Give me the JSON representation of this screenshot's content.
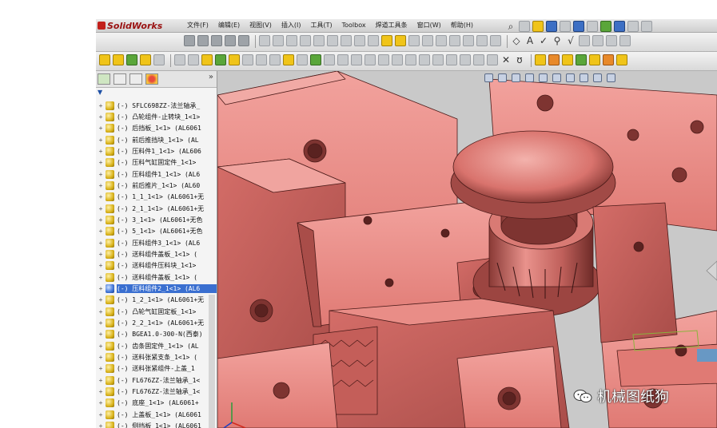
{
  "app": {
    "logo_text": "SolidWorks",
    "brand_color": "#c2201b"
  },
  "menu": [
    {
      "label": "文件(F)"
    },
    {
      "label": "编辑(E)"
    },
    {
      "label": "视图(V)"
    },
    {
      "label": "插入(I)"
    },
    {
      "label": "工具(T)"
    },
    {
      "label": "Toolbox"
    },
    {
      "label": "焊道工具条"
    },
    {
      "label": "窗口(W)"
    },
    {
      "label": "帮助(H)"
    }
  ],
  "panel": {
    "tabs": [
      "feature-manager-tab-icon",
      "property-manager-tab-icon",
      "configuration-manager-tab-icon",
      "appearance-tab-icon"
    ],
    "collapse_glyph": "»",
    "filter_glyph": "▼"
  },
  "tree_items": [
    {
      "text": "(-) SFLC698ZZ-法兰轴承_"
    },
    {
      "text": "(-) 凸轮组件-止转块_1<1>"
    },
    {
      "text": "(-) 后挡板_1<1> (AL6061"
    },
    {
      "text": "(-) 前后推挡块_1<1> (AL"
    },
    {
      "text": "(-) 压料件1_1<1> (AL606"
    },
    {
      "text": "(-) 压料气缸固定件_1<1>"
    },
    {
      "text": "(-) 压料组件1_1<1> (AL6"
    },
    {
      "text": "(-) 前后推片_1<1> (AL60"
    },
    {
      "text": "(-) 1_1_1<1> (AL6061+无"
    },
    {
      "text": "(-) 2_1_1<1> (AL6061+无"
    },
    {
      "text": "(-) 3_1<1> (AL6061+无色"
    },
    {
      "text": "(-) 5_1<1> (AL6061+无色"
    },
    {
      "text": "(-) 压料组件3_1<1> (AL6"
    },
    {
      "text": "(-) 送料组件盖板_1<1> ("
    },
    {
      "text": "(-) 送料组件压料块_1<1>"
    },
    {
      "text": "(-) 送料组件盖板_1<1> ("
    },
    {
      "text": "(-) 压料组件2_1<1> (AL6",
      "selected": true
    },
    {
      "text": "(-) 1_2_1<1> (AL6061+无"
    },
    {
      "text": "(-) 凸轮气缸固定板_1<1>"
    },
    {
      "text": "(-) 2_2_1<1> (AL6061+无"
    },
    {
      "text": "(-) BGEA1.0-300-N(西泰)"
    },
    {
      "text": "(-) 齿条固定件_1<1> (AL"
    },
    {
      "text": "(-) 送料张紧支条_1<1> ("
    },
    {
      "text": "(-) 送料张紧组件-上盖_1"
    },
    {
      "text": "(-) FL676ZZ-法兰轴承_1<"
    },
    {
      "text": "(-) FL676ZZ-法兰轴承_1<"
    },
    {
      "text": "(-) 底座_1<1> (AL6061+"
    },
    {
      "text": "(-) 上盖板_1<1> (AL6061"
    },
    {
      "text": "(-) 侧挡板_1<1> (AL6061"
    }
  ],
  "model_colors": {
    "part": "#e57a76",
    "part_dark": "#b85450",
    "part_light": "#f4a4a0",
    "edge": "#4a1a18"
  },
  "watermark": {
    "text": "机械图纸狗"
  }
}
